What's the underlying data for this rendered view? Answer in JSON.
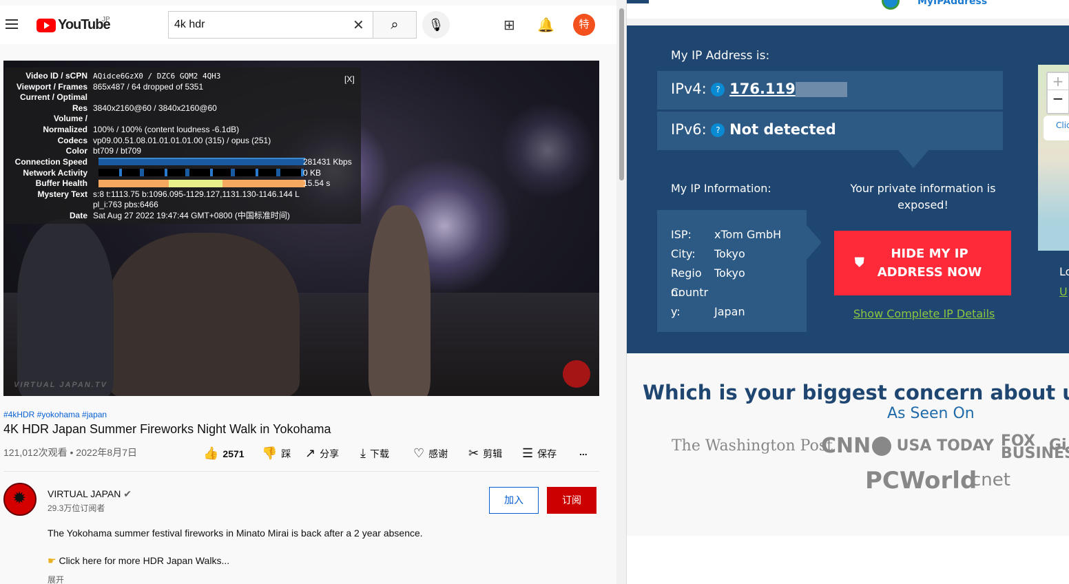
{
  "youtube": {
    "logo_text": "YouTube",
    "region": "JP",
    "search": {
      "value": "4k hdr"
    },
    "avatar_char": "特",
    "stats": {
      "close": "[X]",
      "rows": [
        {
          "label": "Video ID / sCPN",
          "value": "AQidce6GzX0  /  DZC6 GQM2 4QH3"
        },
        {
          "label": "Viewport / Frames",
          "value": "865x487 / 64 dropped of 5351"
        },
        {
          "label": "Current / Optimal",
          "value": ""
        },
        {
          "label": "Res",
          "value": "3840x2160@60 / 3840x2160@60"
        },
        {
          "label": "Volume /",
          "value": ""
        },
        {
          "label": "Normalized",
          "value": "100% / 100% (content loudness -6.1dB)"
        },
        {
          "label": "Codecs",
          "value": "vp09.00.51.08.01.01.01.01.00 (315) / opus (251)"
        },
        {
          "label": "Color",
          "value": "bt709 / bt709"
        },
        {
          "label": "Connection Speed",
          "value": "281431 Kbps"
        },
        {
          "label": "Network Activity",
          "value": "0 KB"
        },
        {
          "label": "Buffer Health",
          "value": "15.54 s"
        },
        {
          "label": "Mystery Text",
          "value": "s:8 t:1113.75 b:1096.095-1129.127,1131.130-1146.144 L"
        },
        {
          "label": "",
          "value": "pl_i:763 pbs:6466"
        },
        {
          "label": "Date",
          "value": "Sat Aug 27 2022 19:47:44 GMT+0800 (中国标准时间)"
        }
      ]
    },
    "watermark": "VIRTUAL JAPAN.TV",
    "tags": "#4kHDR #yokohama #japan",
    "title": "4K HDR Japan Summer Fireworks Night Walk in Yokohama",
    "meta": "121,012次观看 • 2022年8月7日",
    "actions": {
      "likes": "2571",
      "dislike": "踩",
      "share": "分享",
      "download": "下载",
      "thanks": "感谢",
      "clip": "剪辑",
      "save": "保存",
      "more": "..."
    },
    "channel": {
      "name": "VIRTUAL JAPAN",
      "subs": "29.3万位订阅者",
      "join": "加入",
      "subscribe": "订阅"
    },
    "description": [
      "The Yokohama summer festival fireworks in Minato Mirai is back after a 2 year absence.",
      "Click here for more HDR Japan Walks..."
    ],
    "expand": "展开"
  },
  "myip": {
    "logo_text": "MyIPAddress",
    "heading": "My IP Address is:",
    "ipv4_label": "IPv4:",
    "ipv4_value": "176.119",
    "ipv6_label": "IPv6:",
    "ipv6_value": "Not detected",
    "info_heading": "My IP Information:",
    "warning": "Your private information is exposed!",
    "info": [
      {
        "k": "ISP:",
        "v": "xTom GmbH"
      },
      {
        "k": "City:",
        "v": "Tokyo"
      },
      {
        "k": "Region:",
        "v": "Tokyo"
      },
      {
        "k": "Country:",
        "v": "Japan"
      }
    ],
    "hide_button": "HIDE MY IP ADDRESS NOW",
    "details_link": "Show Complete IP Details",
    "map_click": "Clic",
    "side_label": "Lo",
    "side_link": "U",
    "question": "Which is your biggest concern about using",
    "as_seen": "As Seen On",
    "press": [
      "The Washington Post",
      "CNN",
      "USA TODAY",
      "FOX BUSINESS",
      "Gi",
      "PCWorld",
      "cnet"
    ],
    "colors": {
      "panel": "#1f4670",
      "box": "#2d5a85",
      "cta": "#fe2a3a",
      "link": "#8dc63f"
    }
  }
}
